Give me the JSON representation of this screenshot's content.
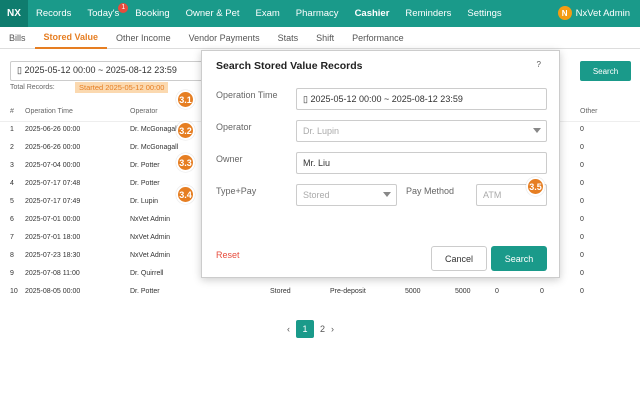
{
  "topbar": {
    "logo": "NX",
    "nav": [
      "Records",
      "Today's",
      "Booking",
      "Owner & Pet",
      "Exam",
      "Pharmacy",
      "Cashier",
      "Reminders",
      "Settings"
    ],
    "badge": "1",
    "user_initial": "N",
    "user_name": "NxVet Admin"
  },
  "subnav": [
    "Bills",
    "Stored Value",
    "Other Income",
    "Vendor Payments",
    "Stats",
    "Shift",
    "Performance"
  ],
  "filter": {
    "date_range": "2025-05-12 00:00 ~ 2025-08-12 23:59",
    "search": "Search"
  },
  "summary": {
    "total_label": "Total Records:",
    "tag": "Started 2025-05-12 00:00"
  },
  "table": {
    "headers": [
      "#",
      "Operation Time",
      "Operator",
      "Other"
    ],
    "rows": [
      {
        "n": "1",
        "time": "2025-06-26 00:00",
        "op": "Dr. McGonagall",
        "type": "",
        "method": "",
        "amt1": "",
        "amt2": "",
        "c1": "",
        "c2": "",
        "other": "0"
      },
      {
        "n": "2",
        "time": "2025-06-26 00:00",
        "op": "Dr. McGonagall",
        "type": "",
        "method": "",
        "amt1": "",
        "amt2": "",
        "c1": "",
        "c2": "",
        "other": "0"
      },
      {
        "n": "3",
        "time": "2025-07-04 00:00",
        "op": "Dr. Potter",
        "type": "",
        "method": "",
        "amt1": "",
        "amt2": "",
        "c1": "",
        "c2": "",
        "other": "0"
      },
      {
        "n": "4",
        "time": "2025-07-17 07:48",
        "op": "Dr. Potter",
        "type": "",
        "method": "",
        "amt1": "",
        "amt2": "",
        "c1": "",
        "c2": "",
        "other": "0"
      },
      {
        "n": "5",
        "time": "2025-07-17 07:49",
        "op": "Dr. Lupin",
        "type": "",
        "method": "",
        "amt1": "",
        "amt2": "",
        "c1": "",
        "c2": "",
        "other": "0"
      },
      {
        "n": "6",
        "time": "2025-07-01 00:00",
        "op": "NxVet Admin",
        "type": "",
        "method": "",
        "amt1": "",
        "amt2": "",
        "c1": "",
        "c2": "",
        "other": "0"
      },
      {
        "n": "7",
        "time": "2025-07-01 18:00",
        "op": "NxVet Admin",
        "type": "",
        "method": "",
        "amt1": "",
        "amt2": "",
        "c1": "",
        "c2": "",
        "other": "0"
      },
      {
        "n": "8",
        "time": "2025-07-23 18:30",
        "op": "NxVet Admin",
        "type": "",
        "method": "",
        "amt1": "",
        "amt2": "",
        "c1": "",
        "c2": "",
        "other": "0"
      },
      {
        "n": "9",
        "time": "2025-07-08 11:00",
        "op": "Dr. Quirrell",
        "type": "",
        "method": "",
        "amt1": "",
        "amt2": "",
        "c1": "",
        "c2": "",
        "other": "0"
      },
      {
        "n": "10",
        "time": "2025-08-05 00:00",
        "op": "Dr. Potter",
        "type": "Stored",
        "method": "Pre-deposit",
        "amt1": "5000",
        "amt2": "5000",
        "c1": "0",
        "c2": "0",
        "other": "0"
      }
    ]
  },
  "pager": {
    "prev": "‹",
    "current": "1",
    "next_page": "2",
    "next": "›"
  },
  "dialog": {
    "title": "Search Stored Value Records",
    "help": "?",
    "labels": {
      "time": "Operation Time",
      "operator": "Operator",
      "owner": "Owner",
      "type": "Type+Pay",
      "method": "Pay Method"
    },
    "values": {
      "time": "2025-05-12 00:00 ~ 2025-08-12 23:59",
      "operator": "Dr. Lupin",
      "owner": "Mr. Liu",
      "type": "Stored",
      "method": "ATM"
    },
    "reset": "Reset",
    "cancel": "Cancel",
    "search": "Search"
  },
  "markers": [
    "3.1",
    "3.2",
    "3.3",
    "3.4",
    "3.5"
  ]
}
